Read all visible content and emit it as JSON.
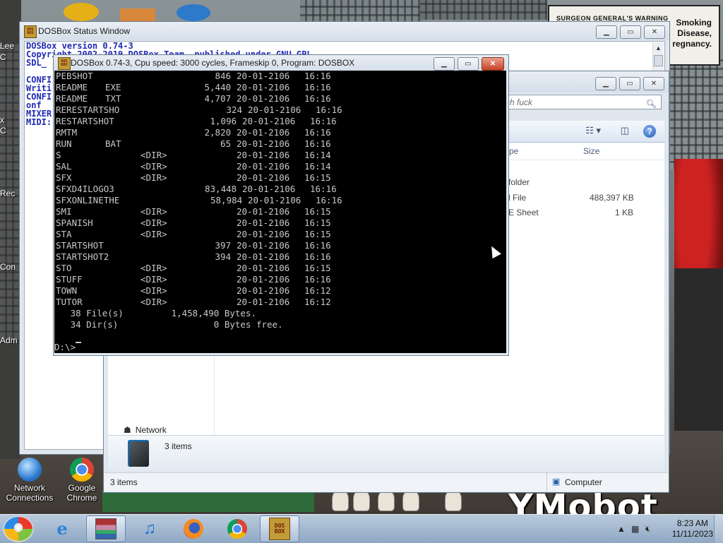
{
  "desktop": {
    "billboard": {
      "warning": "SURGEON GENERAL'S WARNING",
      "lines": [
        "Smoking",
        "Disease,",
        "regnancy."
      ]
    },
    "logo_text": "YMobot",
    "side_labels": [
      "Lee",
      "C",
      "x",
      "C",
      "Rec",
      "Con",
      "Adm"
    ],
    "icons": [
      {
        "label": "Network Connections",
        "icon": "network-globe-icon"
      },
      {
        "label": "Google Chrome",
        "icon": "chrome-icon"
      }
    ]
  },
  "status_window": {
    "title": "DOSBox Status Window",
    "lines": [
      "DOSBox version 0.74-3",
      "Copyright 2002-2019 DOSBox Team, published under GNU GPL.",
      "SDL_",
      "",
      "CONFI",
      "Writi",
      "CONFI",
      "onf",
      "MIXER",
      "MIDI:"
    ]
  },
  "explorer": {
    "search_placeholder": "rch fuck",
    "columns": {
      "type": "pe",
      "size": "Size"
    },
    "rows": [
      {
        "type": "folder",
        "size": ""
      },
      {
        "type": "l File",
        "size": "488,397 KB"
      },
      {
        "type": "E Sheet",
        "size": "1 KB"
      }
    ],
    "nav_network": "Network",
    "details_count": "3 items",
    "status_count": "3 items",
    "status_location": "Computer"
  },
  "dosbox": {
    "title": "DOSBox 0.74-3, Cpu speed:   3000 cycles, Frameskip  0, Program:   DOSBOX",
    "listing": [
      {
        "name": "PEBSHOT",
        "ext": "",
        "size": "846",
        "date": "20-01-2106",
        "time": "16:16"
      },
      {
        "name": "README",
        "ext": "EXE",
        "size": "5,440",
        "date": "20-01-2106",
        "time": "16:16"
      },
      {
        "name": "README",
        "ext": "TXT",
        "size": "4,707",
        "date": "20-01-2106",
        "time": "16:16"
      },
      {
        "name": "RERESTARTSHO",
        "ext": "",
        "size": "324",
        "date": "20-01-2106",
        "time": "16:16"
      },
      {
        "name": "RESTARTSHOT",
        "ext": "",
        "size": "1,096",
        "date": "20-01-2106",
        "time": "16:16"
      },
      {
        "name": "RMTM",
        "ext": "",
        "size": "2,820",
        "date": "20-01-2106",
        "time": "16:16"
      },
      {
        "name": "RUN",
        "ext": "BAT",
        "size": "65",
        "date": "20-01-2106",
        "time": "16:16"
      },
      {
        "name": "S",
        "ext": "",
        "size": "<DIR>",
        "date": "20-01-2106",
        "time": "16:14"
      },
      {
        "name": "SAL",
        "ext": "",
        "size": "<DIR>",
        "date": "20-01-2106",
        "time": "16:14"
      },
      {
        "name": "SFX",
        "ext": "",
        "size": "<DIR>",
        "date": "20-01-2106",
        "time": "16:15"
      },
      {
        "name": "SFXD4ILOGO3",
        "ext": "",
        "size": "83,448",
        "date": "20-01-2106",
        "time": "16:16"
      },
      {
        "name": "SFXONLINETHE",
        "ext": "",
        "size": "58,984",
        "date": "20-01-2106",
        "time": "16:16"
      },
      {
        "name": "SMI",
        "ext": "",
        "size": "<DIR>",
        "date": "20-01-2106",
        "time": "16:15"
      },
      {
        "name": "SPANISH",
        "ext": "",
        "size": "<DIR>",
        "date": "20-01-2106",
        "time": "16:15"
      },
      {
        "name": "STA",
        "ext": "",
        "size": "<DIR>",
        "date": "20-01-2106",
        "time": "16:15"
      },
      {
        "name": "STARTSHOT",
        "ext": "",
        "size": "397",
        "date": "20-01-2106",
        "time": "16:16"
      },
      {
        "name": "STARTSHOT2",
        "ext": "",
        "size": "394",
        "date": "20-01-2106",
        "time": "16:16"
      },
      {
        "name": "STO",
        "ext": "",
        "size": "<DIR>",
        "date": "20-01-2106",
        "time": "16:15"
      },
      {
        "name": "STUFF",
        "ext": "",
        "size": "<DIR>",
        "date": "20-01-2106",
        "time": "16:16"
      },
      {
        "name": "TOWN",
        "ext": "",
        "size": "<DIR>",
        "date": "20-01-2106",
        "time": "16:12"
      },
      {
        "name": "TUTOR",
        "ext": "",
        "size": "<DIR>",
        "date": "20-01-2106",
        "time": "16:12"
      }
    ],
    "summary_files": "   38 File(s)         1,458,490 Bytes.",
    "summary_dirs": "   34 Dir(s)                  0 Bytes free.",
    "prompt": "D:\\>"
  },
  "taskbar": {
    "apps": [
      {
        "name": "internet-explorer",
        "icon": "ie-icon"
      },
      {
        "name": "winrar-archive",
        "icon": "archive-icon"
      },
      {
        "name": "itunes",
        "icon": "music-note-icon"
      },
      {
        "name": "firefox",
        "icon": "firefox-icon"
      },
      {
        "name": "chrome",
        "icon": "chrome-icon"
      },
      {
        "name": "dosbox",
        "icon": "dosbox-icon"
      }
    ],
    "time": "8:23 AM",
    "date": "11/11/2023"
  }
}
